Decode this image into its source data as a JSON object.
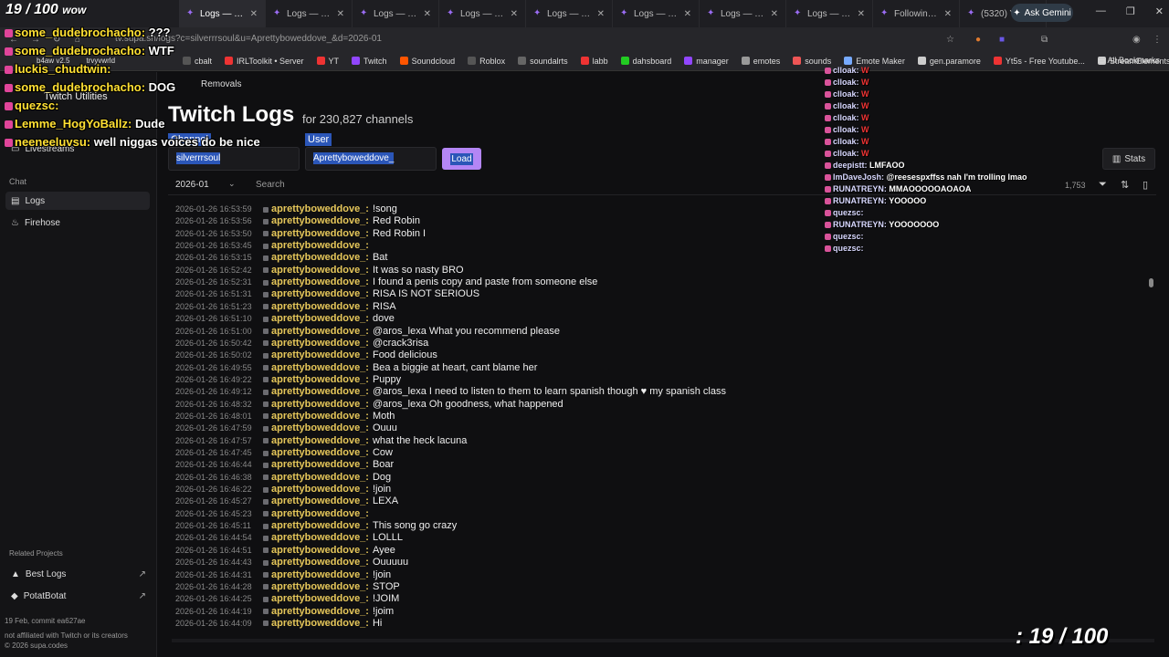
{
  "browser": {
    "tabs": [
      {
        "label": "Logs — Twitch"
      },
      {
        "label": "Logs — Twitch"
      },
      {
        "label": "Logs — Twitch"
      },
      {
        "label": "Logs — Twitch"
      },
      {
        "label": "Logs — Twitch"
      },
      {
        "label": "Logs — Twitch"
      },
      {
        "label": "Logs — Twitch"
      },
      {
        "label": "Logs — Twitch"
      },
      {
        "label": "Following - T"
      },
      {
        "label": "(5320) Yagam"
      }
    ],
    "ask_gemini": "Ask Gemini",
    "url": "tv.supa.sh/logs?c=silverrrsoul&u=Aprettyboweddove_&d=2026-01",
    "bookmarks": [
      "cbalt",
      "IRLToolkit • Server",
      "YT",
      "Twitch",
      "Soundcloud",
      "Roblox",
      "soundalrts",
      "labb",
      "dahsboard",
      "manager",
      "emotes",
      "sounds",
      "Emote Maker",
      "gen.paramore",
      "Yt5s - Free Youtube...",
      "StreamElements - O..."
    ],
    "all_bookmarks": "All Bookmarks",
    "bookmarks_left": [
      "b4aw v2.5",
      "trvyvwrld"
    ]
  },
  "sidebar": {
    "brand": "Twitch Utilities",
    "livestreams": "Livestreams",
    "chat_heading": "Chat",
    "logs": "Logs",
    "firehose": "Firehose",
    "related_heading": "Related Projects",
    "best_logs": "Best Logs",
    "potatbotat": "PotatBotat",
    "commit": "19 Feb, commit ea627ae",
    "disclaimer": "not affiliated with Twitch or its creators",
    "copyright": "© 2026 supa.codes"
  },
  "header": {
    "removals": "Removals",
    "title": "Twitch Logs",
    "subtitle": "for 230,827 channels"
  },
  "form": {
    "channel_label": "Channel",
    "channel_value": "silverrrsoul",
    "user_label": "User",
    "user_value": "Aprettyboweddove_",
    "load": "Load",
    "stats": "Stats"
  },
  "filter": {
    "month": "2026-01",
    "search_placeholder": "Search",
    "count": "1,753"
  },
  "log": [
    {
      "ts": "2026-01-26 16:53:59",
      "user": "aprettyboweddove_:",
      "msg": "!song"
    },
    {
      "ts": "2026-01-26 16:53:56",
      "user": "aprettyboweddove_:",
      "msg": "Red Robin"
    },
    {
      "ts": "2026-01-26 16:53:50",
      "user": "aprettyboweddove_:",
      "msg": "Red Robin I"
    },
    {
      "ts": "2026-01-26 16:53:45",
      "user": "aprettyboweddove_:",
      "msg": ""
    },
    {
      "ts": "2026-01-26 16:53:15",
      "user": "aprettyboweddove_:",
      "msg": "Bat"
    },
    {
      "ts": "2026-01-26 16:52:42",
      "user": "aprettyboweddove_:",
      "msg": "It was so nasty BRO"
    },
    {
      "ts": "2026-01-26 16:52:31",
      "user": "aprettyboweddove_:",
      "msg": "I found a penis copy and paste from someone else"
    },
    {
      "ts": "2026-01-26 16:51:31",
      "user": "aprettyboweddove_:",
      "msg": "RISA IS NOT SERIOUS"
    },
    {
      "ts": "2026-01-26 16:51:23",
      "user": "aprettyboweddove_:",
      "msg": "RISA"
    },
    {
      "ts": "2026-01-26 16:51:10",
      "user": "aprettyboweddove_:",
      "msg": "dove"
    },
    {
      "ts": "2026-01-26 16:51:00",
      "user": "aprettyboweddove_:",
      "msg": "@aros_lexa What you recommend please"
    },
    {
      "ts": "2026-01-26 16:50:42",
      "user": "aprettyboweddove_:",
      "msg": "@crack3risa"
    },
    {
      "ts": "2026-01-26 16:50:02",
      "user": "aprettyboweddove_:",
      "msg": "Food delicious"
    },
    {
      "ts": "2026-01-26 16:49:55",
      "user": "aprettyboweddove_:",
      "msg": "Bea a biggie at heart, cant blame her"
    },
    {
      "ts": "2026-01-26 16:49:22",
      "user": "aprettyboweddove_:",
      "msg": "Puppy"
    },
    {
      "ts": "2026-01-26 16:49:12",
      "user": "aprettyboweddove_:",
      "msg": "@aros_lexa I need to listen to them to learn spanish though ♥ my spanish class"
    },
    {
      "ts": "2026-01-26 16:48:32",
      "user": "aprettyboweddove_:",
      "msg": "@aros_lexa Oh goodness, what happened"
    },
    {
      "ts": "2026-01-26 16:48:01",
      "user": "aprettyboweddove_:",
      "msg": "Moth"
    },
    {
      "ts": "2026-01-26 16:47:59",
      "user": "aprettyboweddove_:",
      "msg": "Ouuu"
    },
    {
      "ts": "2026-01-26 16:47:57",
      "user": "aprettyboweddove_:",
      "msg": "what the heck lacuna"
    },
    {
      "ts": "2026-01-26 16:47:45",
      "user": "aprettyboweddove_:",
      "msg": "Cow"
    },
    {
      "ts": "2026-01-26 16:46:44",
      "user": "aprettyboweddove_:",
      "msg": "Boar"
    },
    {
      "ts": "2026-01-26 16:46:38",
      "user": "aprettyboweddove_:",
      "msg": "Dog"
    },
    {
      "ts": "2026-01-26 16:46:22",
      "user": "aprettyboweddove_:",
      "msg": "!join"
    },
    {
      "ts": "2026-01-26 16:45:27",
      "user": "aprettyboweddove_:",
      "msg": "LEXA"
    },
    {
      "ts": "2026-01-26 16:45:23",
      "user": "aprettyboweddove_:",
      "msg": ""
    },
    {
      "ts": "2026-01-26 16:45:11",
      "user": "aprettyboweddove_:",
      "msg": "This song go crazy"
    },
    {
      "ts": "2026-01-26 16:44:54",
      "user": "aprettyboweddove_:",
      "msg": "LOLLL"
    },
    {
      "ts": "2026-01-26 16:44:51",
      "user": "aprettyboweddove_:",
      "msg": "Ayee"
    },
    {
      "ts": "2026-01-26 16:44:43",
      "user": "aprettyboweddove_:",
      "msg": "Ouuuuu"
    },
    {
      "ts": "2026-01-26 16:44:31",
      "user": "aprettyboweddove_:",
      "msg": "!join"
    },
    {
      "ts": "2026-01-26 16:44:28",
      "user": "aprettyboweddove_:",
      "msg": "STOP"
    },
    {
      "ts": "2026-01-26 16:44:25",
      "user": "aprettyboweddove_:",
      "msg": "!JOIM"
    },
    {
      "ts": "2026-01-26 16:44:19",
      "user": "aprettyboweddove_:",
      "msg": "!joim"
    },
    {
      "ts": "2026-01-26 16:44:09",
      "user": "aprettyboweddove_:",
      "msg": "Hi"
    }
  ],
  "overlay_left": [
    {
      "user": "some_dudebrochacho:",
      "msg": "???"
    },
    {
      "user": "some_dudebrochacho:",
      "msg": "WTF"
    },
    {
      "user": "luckis_chudtwin:",
      "msg": ""
    },
    {
      "user": "some_dudebrochacho:",
      "msg": "DOG"
    },
    {
      "user": "quezsc:",
      "msg": ""
    },
    {
      "user": "Lemme_HogYoBallz:",
      "msg": "Dude"
    },
    {
      "user": "neeneeluvsu:",
      "msg": "well niggas voices do be nice"
    }
  ],
  "overlay_left_counter": "19 / 100",
  "overlay_left_wow": "wow",
  "overlay_right": [
    {
      "user": "clloak:",
      "msg": "W"
    },
    {
      "user": "clloak:",
      "msg": "W"
    },
    {
      "user": "clloak:",
      "msg": "W"
    },
    {
      "user": "clloak:",
      "msg": "W"
    },
    {
      "user": "clloak:",
      "msg": "W"
    },
    {
      "user": "clloak:",
      "msg": "W"
    },
    {
      "user": "clloak:",
      "msg": "W"
    },
    {
      "user": "clloak:",
      "msg": "W"
    },
    {
      "user": "deepistt:",
      "msg": "LMFAOO"
    },
    {
      "user": "ImDaveJosh:",
      "msg": "@reesespxffss nah I'm trolling lmao"
    },
    {
      "user": "RUNATREYN:",
      "msg": "MMAOOOOOAOAOA"
    },
    {
      "user": "RUNATREYN:",
      "msg": "YOOOOO"
    },
    {
      "user": "quezsc:",
      "msg": ""
    },
    {
      "user": "RUNATREYN:",
      "msg": "YOOOOOOO"
    },
    {
      "user": "quezsc:",
      "msg": ""
    },
    {
      "user": "quezsc:",
      "msg": ""
    }
  ],
  "counter": ": 19 / 100"
}
